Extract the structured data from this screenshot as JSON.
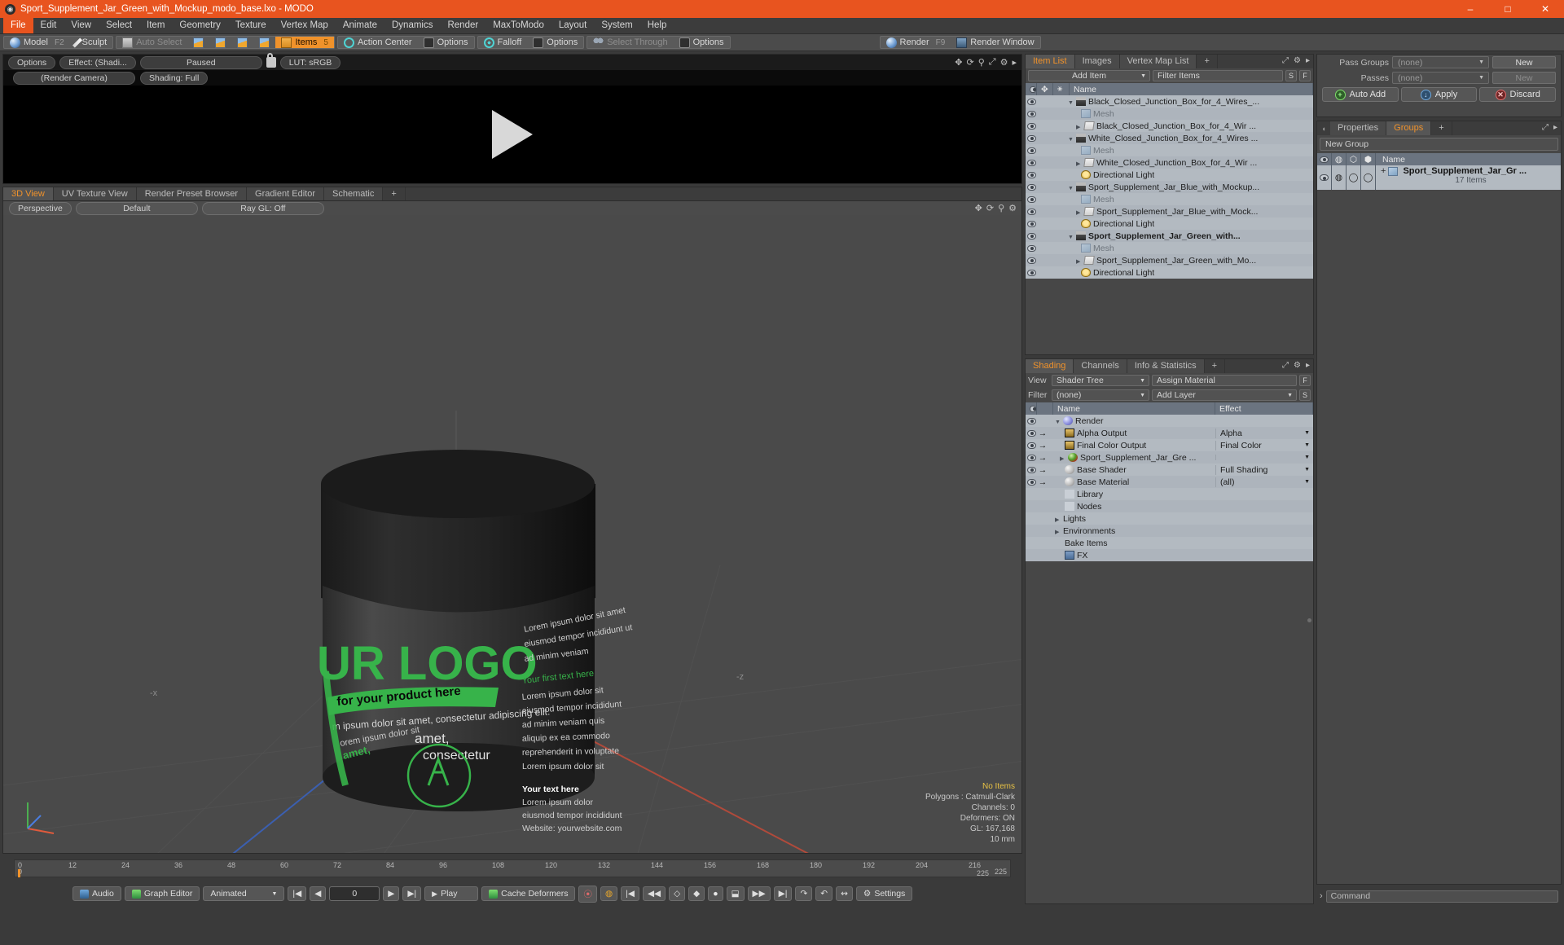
{
  "window": {
    "title": "Sport_Supplement_Jar_Green_with_Mockup_modo_base.lxo - MODO",
    "app_icon": "modo-icon",
    "minimize": "–",
    "maximize": "□",
    "close": "✕",
    "accent": "#e8541f"
  },
  "menu": {
    "items": [
      {
        "label": "File",
        "active": true
      },
      {
        "label": "Edit"
      },
      {
        "label": "View"
      },
      {
        "label": "Select"
      },
      {
        "label": "Item"
      },
      {
        "label": "Geometry"
      },
      {
        "label": "Texture"
      },
      {
        "label": "Vertex Map"
      },
      {
        "label": "Animate"
      },
      {
        "label": "Dynamics"
      },
      {
        "label": "Render"
      },
      {
        "label": "MaxToModo"
      },
      {
        "label": "Layout"
      },
      {
        "label": "System"
      },
      {
        "label": "Help"
      }
    ]
  },
  "toolbar": {
    "model": "Model",
    "model_key": "F2",
    "sculpt": "Sculpt",
    "auto_select": "Auto Select",
    "items": "Items",
    "items_key": "5",
    "action_center": "Action Center",
    "options1": "Options",
    "falloff": "Falloff",
    "options2": "Options",
    "select_through": "Select Through",
    "options3": "Options",
    "render": "Render",
    "render_key": "F9",
    "render_window": "Render Window"
  },
  "render_preview": {
    "options": "Options",
    "effect": "Effect: (Shadi...",
    "paused": "Paused",
    "lock_icon": "unlock-icon",
    "lut": "LUT: sRGB",
    "camera": "(Render Camera)",
    "shading": "Shading: Full",
    "play_icon": "play-icon"
  },
  "viewport": {
    "tabs": [
      {
        "label": "3D View",
        "active": true
      },
      {
        "label": "UV Texture View",
        "active": false
      },
      {
        "label": "Render Preset Browser",
        "active": false
      },
      {
        "label": "Gradient Editor",
        "active": false
      },
      {
        "label": "Schematic",
        "active": false
      },
      {
        "label": "+",
        "active": false
      }
    ],
    "perspective": "Perspective",
    "default": "Default",
    "raygl": "Ray GL: Off",
    "stats": {
      "no_items": "No Items",
      "polygons": "Polygons : Catmull-Clark",
      "channels": "Channels: 0",
      "deformers": "Deformers: ON",
      "gl": "GL: 167,168",
      "grid": "10 mm"
    }
  },
  "timeline": {
    "start": "0",
    "end": "225",
    "ticks": [
      "0",
      "12",
      "24",
      "36",
      "48",
      "60",
      "72",
      "84",
      "96",
      "108",
      "120",
      "132",
      "144",
      "156",
      "168",
      "180",
      "192",
      "204",
      "216"
    ],
    "range_end": "225"
  },
  "transport": {
    "audio": "Audio",
    "graph_editor": "Graph Editor",
    "animated": "Animated",
    "frame": "0",
    "play": "Play",
    "cache_deformers": "Cache Deformers",
    "settings": "Settings"
  },
  "item_list": {
    "tabs": [
      {
        "label": "Item List",
        "active": true
      },
      {
        "label": "Images",
        "active": false
      },
      {
        "label": "Vertex Map List",
        "active": false
      },
      {
        "label": "+",
        "active": false
      }
    ],
    "add_item": "Add Item",
    "filter_items": "Filter Items",
    "btn_s": "S",
    "btn_f": "F",
    "col_name": "Name",
    "rows": [
      {
        "indent": 1,
        "tri": "▼",
        "icon": "clapper-icon",
        "label": "Black_Closed_Junction_Box_for_4_Wires_...",
        "dim": false,
        "eye": true
      },
      {
        "indent": 2,
        "tri": "",
        "icon": "mesh-icon",
        "label": "Mesh",
        "dim": true,
        "eye": true
      },
      {
        "indent": 2,
        "tri": "▶",
        "icon": "folder-icon",
        "label": "Black_Closed_Junction_Box_for_4_Wir ...",
        "dim": false,
        "eye": true
      },
      {
        "indent": 1,
        "tri": "▼",
        "icon": "clapper-icon",
        "label": "White_Closed_Junction_Box_for_4_Wires ...",
        "dim": false,
        "eye": true
      },
      {
        "indent": 2,
        "tri": "",
        "icon": "mesh-icon",
        "label": "Mesh",
        "dim": true,
        "eye": true
      },
      {
        "indent": 2,
        "tri": "▶",
        "icon": "folder-icon",
        "label": "White_Closed_Junction_Box_for_4_Wir ...",
        "dim": false,
        "eye": true
      },
      {
        "indent": 2,
        "tri": "",
        "icon": "light-icon",
        "label": "Directional Light",
        "dim": false,
        "eye": true
      },
      {
        "indent": 1,
        "tri": "▼",
        "icon": "clapper-icon",
        "label": "Sport_Supplement_Jar_Blue_with_Mockup...",
        "dim": false,
        "eye": true
      },
      {
        "indent": 2,
        "tri": "",
        "icon": "mesh-icon",
        "label": "Mesh",
        "dim": true,
        "eye": true
      },
      {
        "indent": 2,
        "tri": "▶",
        "icon": "folder-icon",
        "label": "Sport_Supplement_Jar_Blue_with_Mock...",
        "dim": false,
        "eye": true
      },
      {
        "indent": 2,
        "tri": "",
        "icon": "light-icon",
        "label": "Directional Light",
        "dim": false,
        "eye": true
      },
      {
        "indent": 1,
        "tri": "▼",
        "icon": "clapper-icon",
        "label": "Sport_Supplement_Jar_Green_with...",
        "dim": false,
        "bold": true,
        "eye": true
      },
      {
        "indent": 2,
        "tri": "",
        "icon": "mesh-icon",
        "label": "Mesh",
        "dim": true,
        "eye": true
      },
      {
        "indent": 2,
        "tri": "▶",
        "icon": "folder-icon",
        "label": "Sport_Supplement_Jar_Green_with_Mo...",
        "dim": false,
        "eye": true
      },
      {
        "indent": 2,
        "tri": "",
        "icon": "light-icon",
        "label": "Directional Light",
        "dim": false,
        "eye": true
      }
    ]
  },
  "shading": {
    "tabs": [
      {
        "label": "Shading",
        "active": true
      },
      {
        "label": "Channels",
        "active": false
      },
      {
        "label": "Info & Statistics",
        "active": false
      },
      {
        "label": "+",
        "active": false
      }
    ],
    "view_label": "View",
    "view_value": "Shader Tree",
    "assign_material": "Assign Material",
    "btn_f": "F",
    "filter_label": "Filter",
    "filter_value": "(none)",
    "add_layer": "Add Layer",
    "btn_s": "S",
    "col_name": "Name",
    "col_effect": "Effect",
    "rows": [
      {
        "indent": 1,
        "tri": "▼",
        "icon": "sphere-icon",
        "label": "Render",
        "effect": ""
      },
      {
        "indent": 2,
        "tri": "",
        "icon": "image-icon",
        "label": "Alpha Output",
        "effect": "Alpha"
      },
      {
        "indent": 2,
        "tri": "",
        "icon": "image-icon",
        "label": "Final Color Output",
        "effect": "Final Color"
      },
      {
        "indent": 2,
        "tri": "▶",
        "icon": "material-icon",
        "label": "Sport_Supplement_Jar_Gre ...",
        "effect": ""
      },
      {
        "indent": 2,
        "tri": "",
        "icon": "shader-icon",
        "label": "Base Shader",
        "effect": "Full Shading"
      },
      {
        "indent": 2,
        "tri": "",
        "icon": "shader-icon",
        "label": "Base Material",
        "effect": "(all)"
      },
      {
        "indent": 1,
        "tri": "",
        "icon": "wrench-icon",
        "label": "Library",
        "effect": ""
      },
      {
        "indent": 1,
        "tri": "",
        "icon": "wrench-icon",
        "label": "Nodes",
        "effect": ""
      },
      {
        "indent": 1,
        "tri": "▶",
        "icon": "none",
        "label": "Lights",
        "effect": ""
      },
      {
        "indent": 1,
        "tri": "▶",
        "icon": "none",
        "label": "Environments",
        "effect": ""
      },
      {
        "indent": 1,
        "tri": "",
        "icon": "none",
        "label": "Bake Items",
        "effect": ""
      },
      {
        "indent": 1,
        "tri": "",
        "icon": "fx-icon",
        "label": "FX",
        "effect": ""
      }
    ]
  },
  "passes": {
    "pass_groups_label": "Pass Groups",
    "pass_groups_value": "(none)",
    "pass_groups_new": "New",
    "passes_label": "Passes",
    "passes_value": "(none)",
    "passes_new": "New",
    "auto_add": "Auto Add",
    "apply": "Apply",
    "discard": "Discard"
  },
  "groups": {
    "tabs": [
      {
        "label": "Properties",
        "active": false
      },
      {
        "label": "Groups",
        "active": true
      },
      {
        "label": "+",
        "active": false
      }
    ],
    "new_group": "New Group",
    "col_name": "Name",
    "item_label": "Sport_Supplement_Jar_Gr ...",
    "item_count": "17 Items"
  },
  "command": {
    "placeholder": "Command",
    "prompt": "›"
  }
}
